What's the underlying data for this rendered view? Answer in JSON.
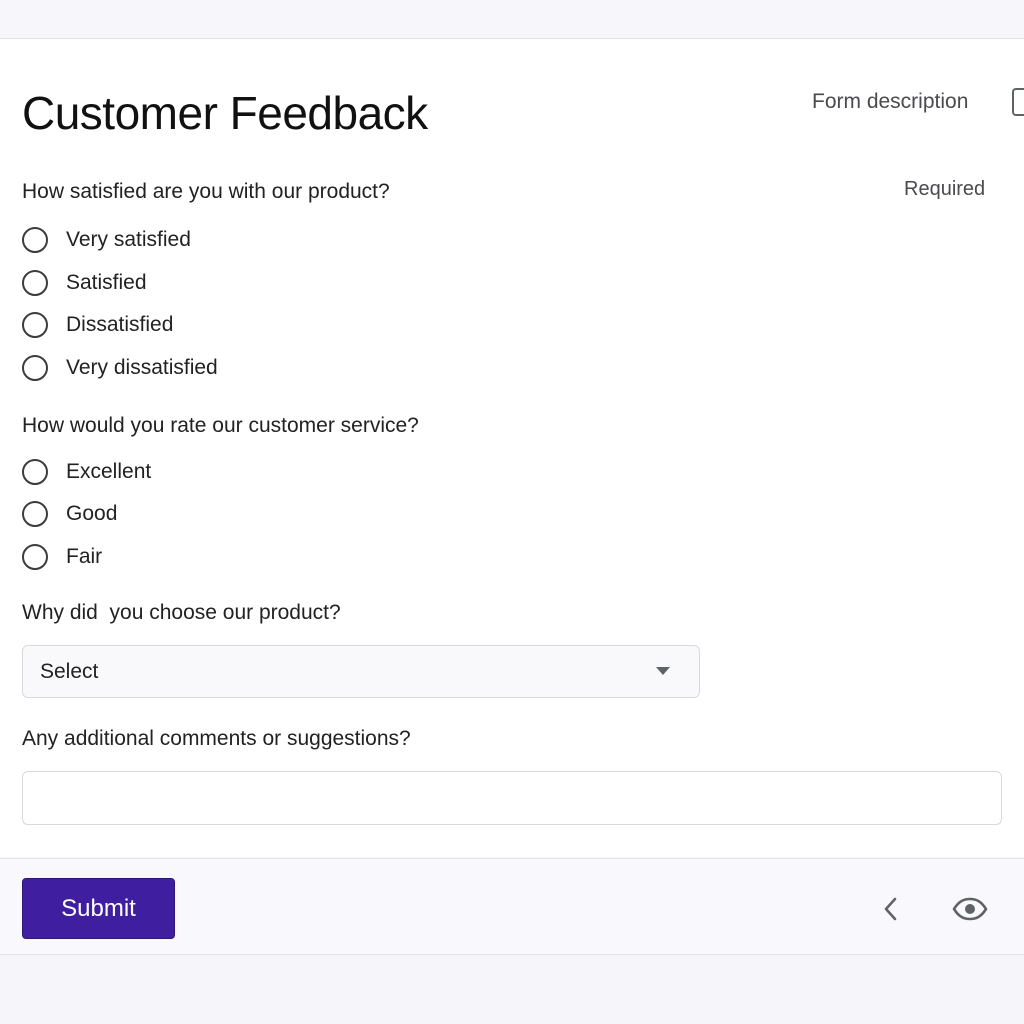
{
  "form": {
    "title": "Customer Feedback",
    "description_label": "Form description",
    "required_label": "Required"
  },
  "questions": [
    {
      "text": "How satisfied are you with our product?",
      "options": [
        "Very satisfied",
        "Satisfied",
        "Dissatisfied",
        "Very dissatisfied"
      ]
    },
    {
      "text": "How would you rate our customer service?",
      "options": [
        "Excellent",
        "Good",
        "Fair"
      ]
    },
    {
      "text": "Why did  you choose our product?",
      "select_value": "Select"
    },
    {
      "text": "Any additional comments or suggestions?",
      "input_value": "",
      "input_placeholder": ""
    }
  ],
  "footer": {
    "submit_label": "Submit",
    "back_icon": "chevron-left-icon",
    "preview_icon": "eye-icon"
  },
  "colors": {
    "accent": "#3f1fa0",
    "page_background": "#f6f5f9"
  }
}
